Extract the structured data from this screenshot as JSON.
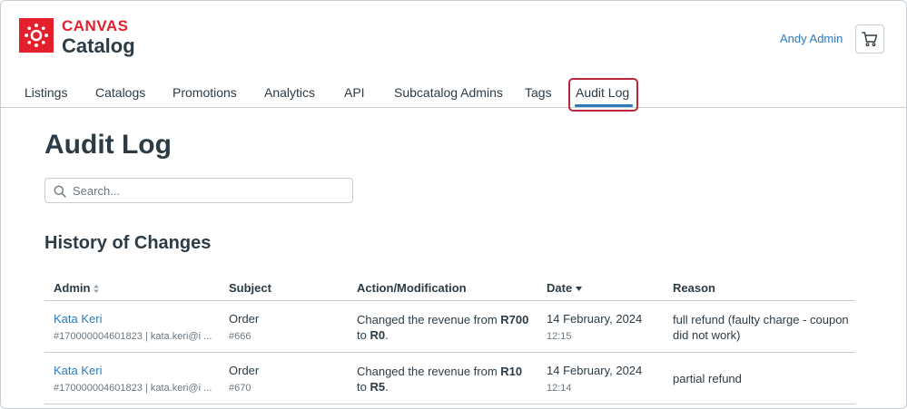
{
  "app": {
    "brand_top": "CANVAS",
    "brand_bottom": "Catalog",
    "user_name": "Andy Admin"
  },
  "nav": {
    "tabs": [
      {
        "label": "Listings"
      },
      {
        "label": "Catalogs"
      },
      {
        "label": "Promotions"
      },
      {
        "label": "Analytics"
      },
      {
        "label": "API"
      },
      {
        "label": "Subcatalog Admins"
      },
      {
        "label": "Tags"
      },
      {
        "label": "Audit Log"
      }
    ],
    "active": "Audit Log"
  },
  "page": {
    "title": "Audit Log",
    "search_placeholder": "Search...",
    "section_title": "History of Changes"
  },
  "table": {
    "columns": [
      "Admin",
      "Subject",
      "Action/Modification",
      "Date",
      "Reason"
    ],
    "sort": {
      "column": "Date",
      "direction": "descending"
    },
    "rows": [
      {
        "admin_name": "Kata Keri",
        "admin_detail": "#170000004601823 | kata.keri@i ...",
        "subject": "Order",
        "subject_id": "#666",
        "action_prefix": "Changed the revenue from ",
        "action_from": "R700",
        "action_mid": " to ",
        "action_to": "R0",
        "action_suffix": ".",
        "date": "14 February, 2024",
        "time": "12:15",
        "reason": "full refund (faulty charge - coupon did not work)"
      },
      {
        "admin_name": "Kata Keri",
        "admin_detail": "#170000004601823 | kata.keri@i ...",
        "subject": "Order",
        "subject_id": "#670",
        "action_prefix": "Changed the revenue from ",
        "action_from": "R10",
        "action_mid": " to ",
        "action_to": "R5",
        "action_suffix": ".",
        "date": "14 February, 2024",
        "time": "12:14",
        "reason": "partial refund"
      }
    ]
  },
  "colors": {
    "brand_red": "#e4202d",
    "link_blue": "#2b7abc",
    "text": "#2d3b45",
    "highlight_border": "#b8283c"
  }
}
